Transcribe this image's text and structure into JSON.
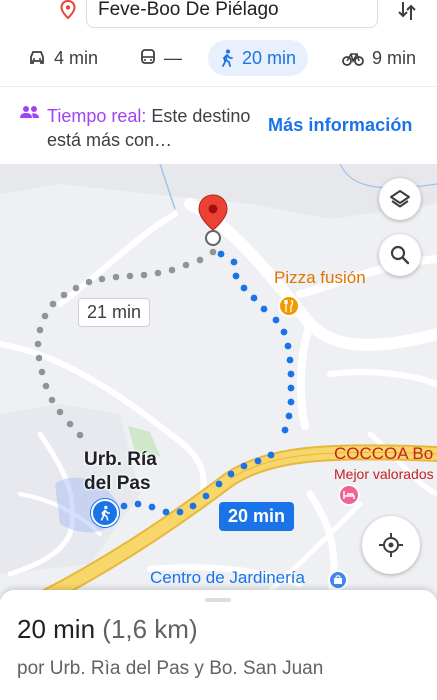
{
  "search": {
    "destination": "Feve-Boo De Piélago"
  },
  "modes": {
    "car": "4 min",
    "transit": "—",
    "walk": "20 min",
    "bike": "9 min"
  },
  "notice": {
    "title": "Tiempo real:",
    "body": " Este destino está más con…",
    "link": "Más información"
  },
  "map": {
    "poi_pizza": "Pizza fusión",
    "poi_coccoa": "COCCOA Bo",
    "poi_coccoa_sub": "Mejor valorados",
    "poi_garden": "Centro de Jardinería",
    "area_label": "Urb. Ría del Pas",
    "alt_route_time": "21 min",
    "main_route_time": "20 min",
    "colors": {
      "route": "#1a73e8",
      "alt_route": "#9aa0a6",
      "pin": "#ea4335",
      "highway": "#f6d35c"
    }
  },
  "sheet": {
    "time": "20 min",
    "distance": "(1,6 km)",
    "via": "por Urb. Rìa del Pas y Bo. San Juan"
  }
}
